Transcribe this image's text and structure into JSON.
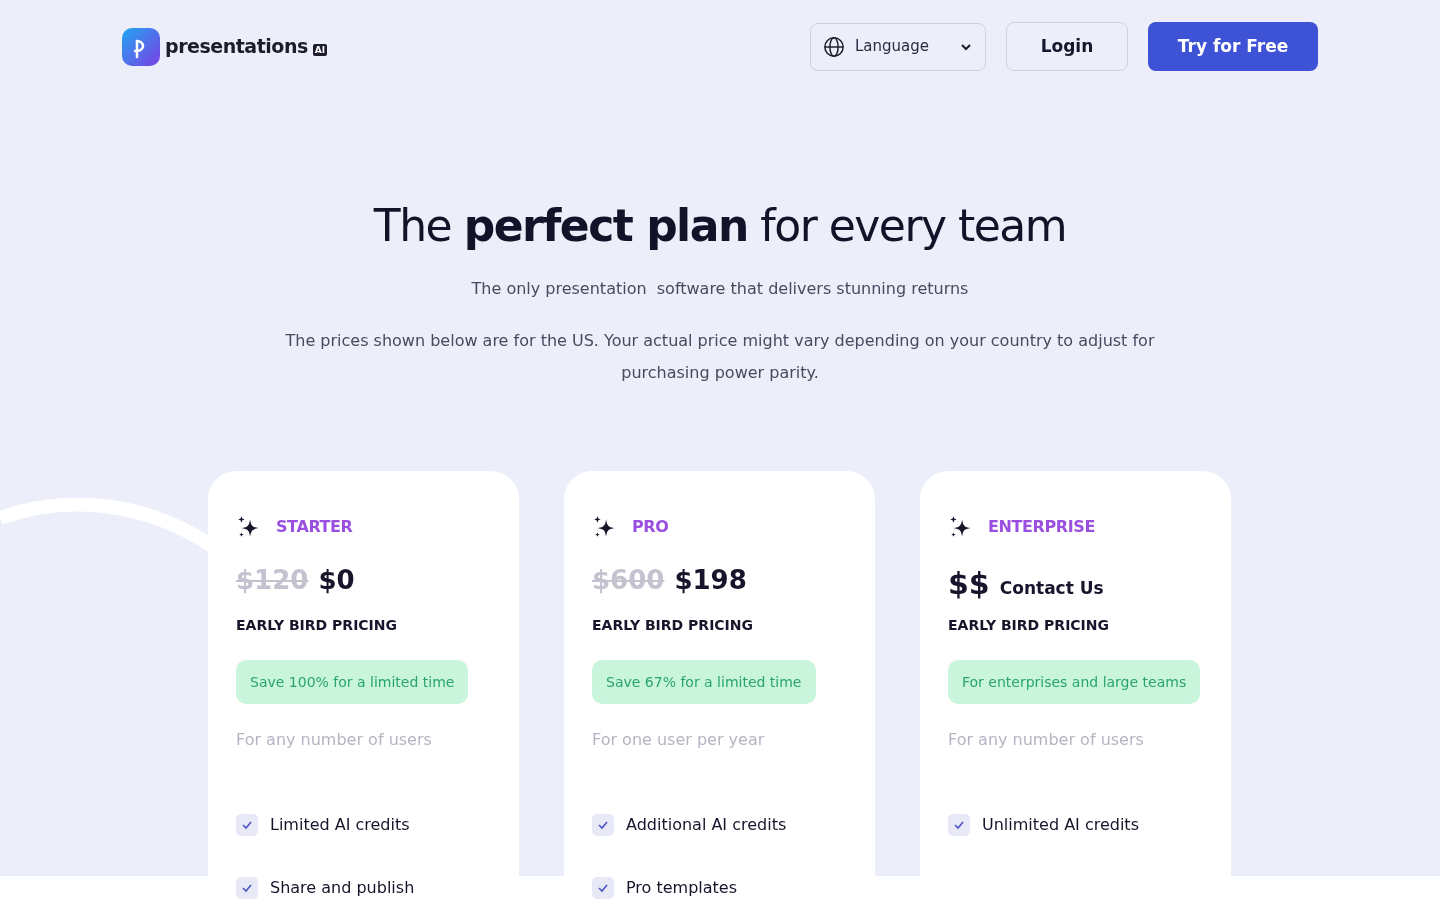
{
  "header": {
    "logo_text": "presentations",
    "logo_badge": "AI",
    "language": "Language",
    "login": "Login",
    "cta": "Try for Free"
  },
  "hero": {
    "title": "The **perfect plan** for every team",
    "subtitle": "The only presentation  software that delivers stunning returns",
    "note": "The prices shown below are for the US. Your actual price might vary depending on your country to adjust for purchasing power parity."
  },
  "plans": [
    {
      "kind": "discount",
      "name": "STARTER",
      "old_price": "$120",
      "price": "$0",
      "pricing_label": "EARLY BIRD PRICING",
      "badge": "Save 100% for a limited time",
      "audience": "For any number of users",
      "features": [
        {
          "label": "Limited AI credits",
          "checked": true
        },
        {
          "label": "Share and publish",
          "checked": true
        }
      ]
    },
    {
      "kind": "discount",
      "name": "PRO",
      "old_price": "$600",
      "price": "$198",
      "pricing_label": "EARLY BIRD PRICING",
      "badge": "Save 67% for a limited time",
      "audience": "For one user per year",
      "features": [
        {
          "label": "Additional AI credits",
          "checked": true
        },
        {
          "label": "Pro templates",
          "checked": true
        }
      ]
    },
    {
      "kind": "contact",
      "name": "ENTERPRISE",
      "symbol": "$$",
      "price": "Contact Us",
      "pricing_label": "EARLY BIRD PRICING",
      "badge": "For enterprises and large teams",
      "audience": "For any number of users",
      "features": [
        {
          "label": "Unlimited AI credits",
          "checked": true
        }
      ]
    }
  ]
}
